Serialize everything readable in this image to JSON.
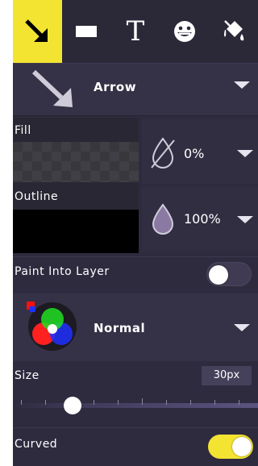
{
  "toolbar": {
    "tools": [
      {
        "name": "arrow",
        "icon": "arrow-icon",
        "active": true
      },
      {
        "name": "rectangle",
        "icon": "rectangle-icon",
        "active": false
      },
      {
        "name": "text",
        "icon": "text-icon",
        "label": "T",
        "active": false
      },
      {
        "name": "emoji",
        "icon": "emoji-icon",
        "active": false
      },
      {
        "name": "fill",
        "icon": "paint-bucket-icon",
        "active": false
      }
    ],
    "active_color": "#f4e432"
  },
  "shape": {
    "label": "Arrow"
  },
  "fill": {
    "label": "Fill",
    "opacity": "0%"
  },
  "outline": {
    "label": "Outline",
    "opacity": "100%",
    "color": "#000000"
  },
  "paint_into_layer": {
    "label": "Paint Into Layer",
    "enabled": false
  },
  "blend": {
    "label": "Normal"
  },
  "size": {
    "label": "Size",
    "value": "30px",
    "slider_fraction": 0.15
  },
  "curved": {
    "label": "Curved",
    "enabled": true,
    "on_color": "#f4e432"
  }
}
